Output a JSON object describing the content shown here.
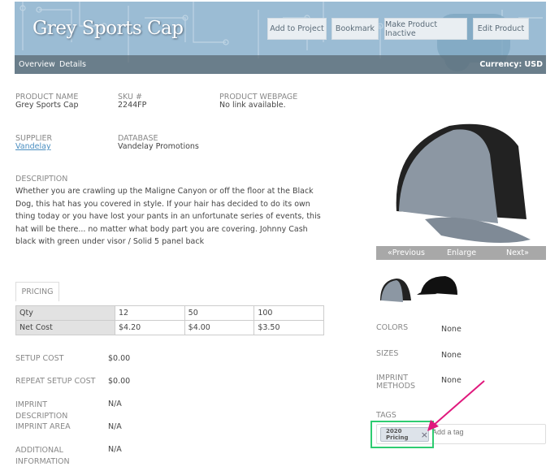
{
  "header": {
    "title": "Grey Sports Cap",
    "buttons": [
      "Add to Project",
      "Bookmark",
      "Make Product Inactive",
      "Edit Product"
    ],
    "nav": [
      "Overview",
      "Details"
    ],
    "currency": "Currency:  USD"
  },
  "info": {
    "product_name_label": "PRODUCT NAME",
    "product_name": "Grey Sports Cap",
    "sku_label": "SKU #",
    "sku": "2244FP",
    "webpage_label": "PRODUCT WEBPAGE",
    "webpage": "No link available.",
    "supplier_label": "SUPPLIER",
    "supplier": "Vandelay",
    "database_label": "DATABASE",
    "database": "Vandelay Promotions",
    "description_label": "DESCRIPTION",
    "description": "Whether you are crawling up the Maligne Canyon or off the floor at the Black Dog, this hat has you covered in style. If your hair has decided to do its own thing today or you have lost your pants in an unfortunate series of events, this hat will be there... no matter what body part you are covering. Johnny Cash black with green under visor / Solid 5 panel back"
  },
  "pricing": {
    "tab": "PRICING",
    "rows": [
      [
        "Qty",
        "12",
        "50",
        "100"
      ],
      [
        "Net Cost",
        "$4.20",
        "$4.00",
        "$3.50"
      ]
    ]
  },
  "costs": [
    {
      "label": "SETUP COST",
      "value": "$0.00"
    },
    {
      "label": "REPEAT SETUP COST",
      "value": "$0.00"
    },
    {
      "label": "IMPRINT DESCRIPTION",
      "value": "N/A"
    },
    {
      "label": "IMPRINT AREA",
      "value": "N/A"
    },
    {
      "label": "ADDITIONAL INFORMATION",
      "value": "N/A"
    }
  ],
  "gallery": {
    "prev": "«Previous",
    "enlarge": "Enlarge",
    "next": "Next»"
  },
  "attributes": [
    {
      "label": "COLORS",
      "value": "None"
    },
    {
      "label": "SIZES",
      "value": "None"
    },
    {
      "label": "IMPRINT METHODS",
      "value": "None"
    }
  ],
  "tags": {
    "label": "TAGS",
    "items": [
      "2020 Pricing"
    ],
    "placeholder": "Add a tag"
  },
  "colors": {
    "highlight": "#2ecc71",
    "arrow": "#e0197d"
  }
}
